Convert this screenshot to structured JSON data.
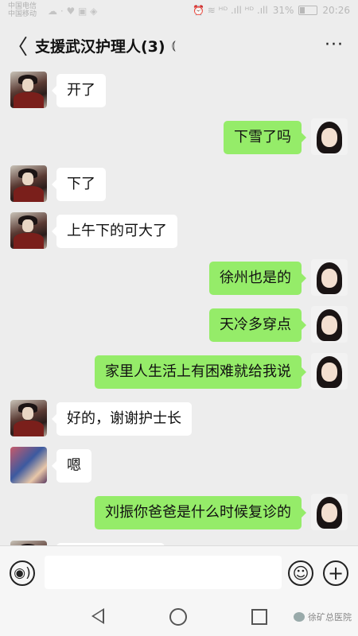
{
  "status_bar": {
    "carrier_1": "中国电信",
    "carrier_2": "中国移动",
    "indicators": "☁ · ♥ ▣ ◈",
    "signal": "⏰ ≋ ᴴᴰ .ıll ᴴᴰ .ıll",
    "battery_percent": "31%",
    "time": "20:26"
  },
  "header": {
    "back_icon": "chevron-left-icon",
    "back_glyph": "〈",
    "title": "支援武汉护理人(3)",
    "ear_glyph": "⦅",
    "more_glyph": "···"
  },
  "messages": [
    {
      "side": "left",
      "avatar": "warrior-avatar",
      "text": "开了"
    },
    {
      "side": "right",
      "avatar": "girl-avatar",
      "text": "下雪了吗"
    },
    {
      "side": "left",
      "avatar": "warrior-avatar",
      "text": "下了"
    },
    {
      "side": "left",
      "avatar": "warrior-avatar",
      "text": "上午下的可大了"
    },
    {
      "side": "right",
      "avatar": "girl-avatar",
      "text": "徐州也是的"
    },
    {
      "side": "right",
      "avatar": "girl-avatar",
      "text": "天冷多穿点"
    },
    {
      "side": "right",
      "avatar": "girl-avatar",
      "text": "家里人生活上有困难就给我说"
    },
    {
      "side": "left",
      "avatar": "warrior-avatar",
      "text": "好的，谢谢护士长"
    },
    {
      "side": "left",
      "avatar": "photo-avatar",
      "text": "嗯"
    },
    {
      "side": "right",
      "avatar": "girl-avatar",
      "text": "刘振你爸爸是什么时候复诊的"
    }
  ],
  "input_bar": {
    "voice_glyph": "◉)",
    "emoji_glyph": "☺",
    "plus_glyph": "+",
    "placeholder": ""
  },
  "watermark": {
    "text": "徐矿总医院"
  }
}
